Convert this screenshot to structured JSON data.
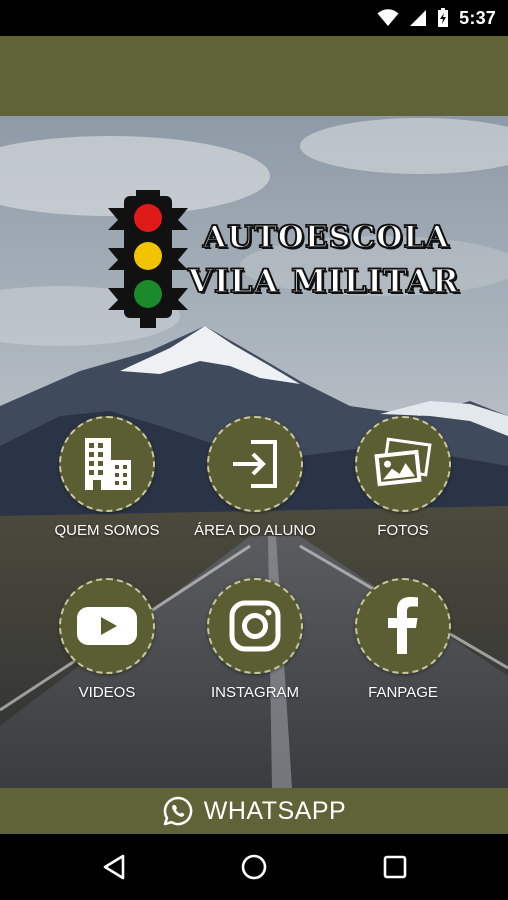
{
  "status_bar": {
    "time": "5:37",
    "icons": [
      "wifi-icon",
      "cell-signal-icon",
      "battery-charging-icon"
    ]
  },
  "app": {
    "brand": {
      "line1": "AUTOESCOLA",
      "line2": "VILA MILITAR",
      "logo_icon": "traffic-light-icon"
    },
    "colors": {
      "primary": "#5f6337",
      "tile_bg": "#5a5e32",
      "traffic_red": "#e01919",
      "traffic_yellow": "#f2c300",
      "traffic_green": "#1a8a2a"
    },
    "menu": [
      {
        "label": "QUEM SOMOS",
        "icon": "building-icon"
      },
      {
        "label": "ÁREA DO ALUNO",
        "icon": "login-door-icon"
      },
      {
        "label": "FOTOS",
        "icon": "photos-icon"
      },
      {
        "label": "VIDEOS",
        "icon": "youtube-icon"
      },
      {
        "label": "INSTAGRAM",
        "icon": "instagram-icon"
      },
      {
        "label": "FANPAGE",
        "icon": "facebook-icon"
      }
    ],
    "whatsapp": {
      "label": "WHATSAPP",
      "icon": "whatsapp-icon"
    }
  },
  "nav_bar": {
    "buttons": [
      "back-icon",
      "home-icon",
      "recents-icon"
    ]
  }
}
